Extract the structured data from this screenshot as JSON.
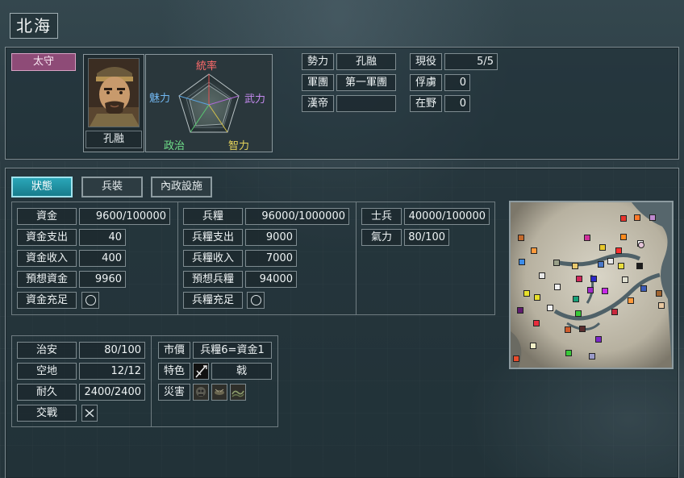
{
  "city_name": "北海",
  "role": "太守",
  "governor": {
    "name": "孔融"
  },
  "radar": {
    "leadership": "統率",
    "war": "武力",
    "intelligence": "智力",
    "politics": "政治",
    "charm": "魅力"
  },
  "info": {
    "force_label": "勢力",
    "force_value": "孔融",
    "army_label": "軍團",
    "army_value": "第一軍團",
    "emperor_label": "漢帝",
    "emperor_value": "",
    "active_label": "現役",
    "active_value": "5/5",
    "prisoner_label": "俘虜",
    "prisoner_value": "0",
    "free_label": "在野",
    "free_value": "0"
  },
  "tabs": [
    "狀態",
    "兵裝",
    "內政設施"
  ],
  "funds": {
    "gold_label": "資金",
    "gold_value": "9600/100000",
    "expense_label": "資金支出",
    "expense_value": "40",
    "income_label": "資金收入",
    "income_value": "400",
    "forecast_label": "預想資金",
    "forecast_value": "9960",
    "sufficient_label": "資金充足"
  },
  "food": {
    "food_label": "兵糧",
    "food_value": "96000/1000000",
    "expense_label": "兵糧支出",
    "expense_value": "9000",
    "income_label": "兵糧收入",
    "income_value": "7000",
    "forecast_label": "預想兵糧",
    "forecast_value": "94000",
    "sufficient_label": "兵糧充足"
  },
  "troops": {
    "soldiers_label": "士兵",
    "soldiers_value": "40000/100000",
    "morale_label": "氣力",
    "morale_value": "80/100"
  },
  "city": {
    "order_label": "治安",
    "order_value": "80/100",
    "land_label": "空地",
    "land_value": "12/12",
    "durability_label": "耐久",
    "durability_value": "2400/2400",
    "battle_label": "交戰",
    "market_label": "市價",
    "market_value": "兵糧6=資金1",
    "specialty_label": "特色",
    "specialty_value": "戟",
    "disaster_label": "災害"
  },
  "colors": {
    "role_bg": "#8e4b77",
    "tab_active": "#2aa6b8",
    "panel_border": "#7c8a90"
  }
}
